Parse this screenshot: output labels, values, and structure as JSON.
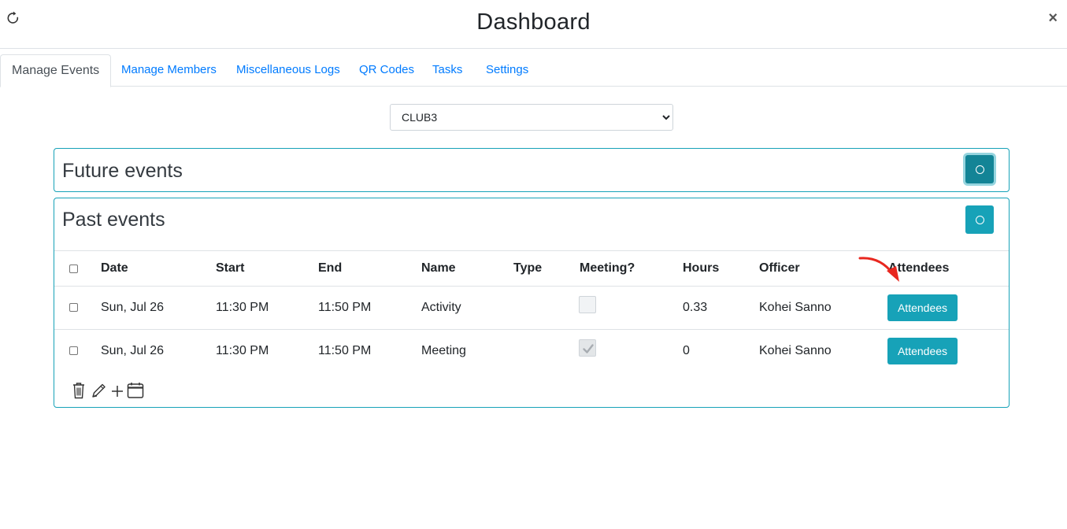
{
  "header": {
    "title": "Dashboard",
    "refresh_icon": "refresh-icon",
    "close_label": "×"
  },
  "tabs": [
    {
      "label": "Manage Events",
      "active": true
    },
    {
      "label": "Manage Members"
    },
    {
      "label": "Miscellaneous Logs"
    },
    {
      "label": "QR Codes"
    },
    {
      "label": "Tasks"
    },
    {
      "label": "Settings"
    }
  ],
  "club_select": {
    "value": "CLUB3",
    "options": [
      "CLUB3"
    ]
  },
  "future_panel": {
    "title": "Future events"
  },
  "past_panel": {
    "title": "Past events",
    "columns": [
      "Date",
      "Start",
      "End",
      "Name",
      "Type",
      "Meeting?",
      "Hours",
      "Officer",
      "Attendees"
    ],
    "rows": [
      {
        "date": "Sun, Jul 26",
        "start": "11:30 PM",
        "end": "11:50 PM",
        "name": "Activity",
        "type": "",
        "meeting": false,
        "hours": "0.33",
        "officer": "Kohei Sanno",
        "button": "Attendees"
      },
      {
        "date": "Sun, Jul 26",
        "start": "11:30 PM",
        "end": "11:50 PM",
        "name": "Meeting",
        "type": "",
        "meeting": true,
        "hours": "0",
        "officer": "Kohei Sanno",
        "button": "Attendees"
      }
    ],
    "tools": [
      "trash-icon",
      "pencil-icon",
      "plus-icon",
      "calendar-icon"
    ]
  },
  "colors": {
    "accent": "#17a2b8",
    "link": "#007bff",
    "annotation_arrow": "#e8271f"
  }
}
